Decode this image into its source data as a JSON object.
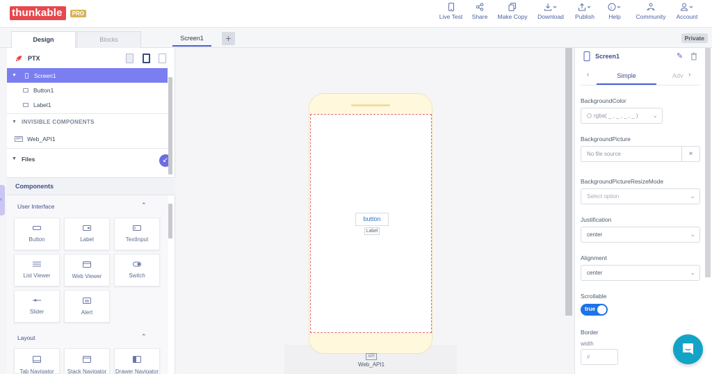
{
  "app": {
    "logo": "thunkable",
    "plan": "PRO"
  },
  "top_actions": [
    {
      "label": "Live Test",
      "icon": "phone-icon"
    },
    {
      "label": "Share",
      "icon": "share-icon"
    },
    {
      "label": "Make Copy",
      "icon": "copy-icon"
    },
    {
      "label": "Download",
      "icon": "download-icon"
    },
    {
      "label": "Publish",
      "icon": "publish-icon"
    },
    {
      "label": "Help",
      "icon": "help-icon"
    },
    {
      "label": "Community",
      "icon": "community-icon"
    },
    {
      "label": "Account",
      "icon": "account-icon"
    }
  ],
  "tabs": {
    "design": "Design",
    "blocks": "Blocks",
    "screen": "Screen1",
    "add": "+",
    "private": "Private"
  },
  "project": {
    "name": "PTX",
    "tree": {
      "screen": "Screen1",
      "button": "Button1",
      "label": "Label1",
      "invisible_header": "INVISIBLE COMPONENTS",
      "web_api": "Web_API1",
      "files": "Files"
    }
  },
  "components": {
    "title": "Components",
    "user_interface": "User Interface",
    "layout": "Layout",
    "ui_items": [
      "Button",
      "Label",
      "TextInput",
      "List Viewer",
      "Web Viewer",
      "Switch",
      "Slider",
      "Alert"
    ],
    "layout_items": [
      "Tab Navigator",
      "Stack Navigator",
      "Drawer Navigator"
    ]
  },
  "canvas": {
    "button_text": "button",
    "label_text": "Label",
    "invisible_icon_text": "API",
    "invisible_component": "Web_API1"
  },
  "properties": {
    "title": "Screen1",
    "tab_simple": "Simple",
    "tab_advanced": "Adv",
    "background_color_label": "BackgroundColor",
    "background_color_value": "rgba( _ , _ , _ , _ )",
    "background_picture_label": "BackgroundPicture",
    "background_picture_value": "No file source",
    "resize_mode_label": "BackgroundPictureResizeMode",
    "resize_mode_placeholder": "Select option",
    "justification_label": "Justification",
    "justification_value": "center",
    "alignment_label": "Alignment",
    "alignment_value": "center",
    "scrollable_label": "Scrollable",
    "scrollable_value": "true",
    "border_label": "Border",
    "width_label": "width",
    "width_placeholder": "#"
  },
  "colors": {
    "brand": "#e5484d",
    "selected_row": "#7b7ef0",
    "accent": "#4a5fd0",
    "toggle": "#1f73e8",
    "chat": "#13a3c7"
  }
}
